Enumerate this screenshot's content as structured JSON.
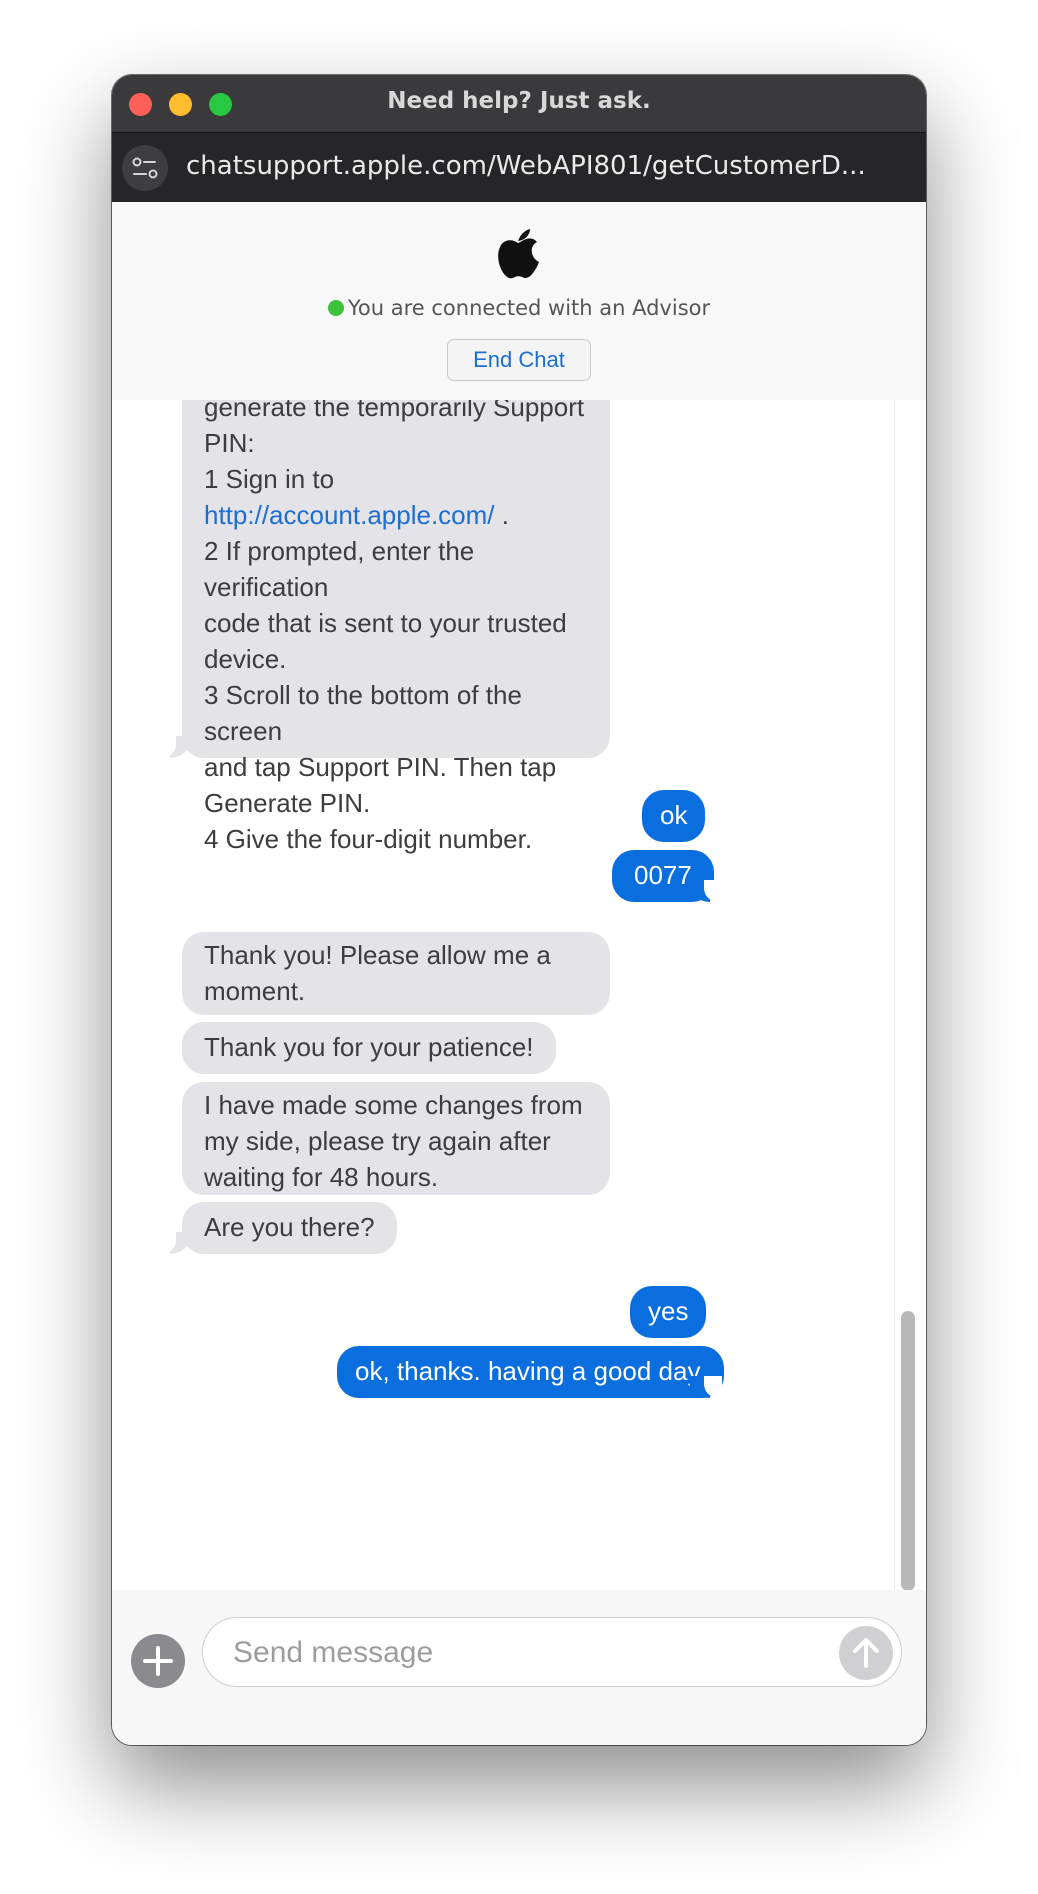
{
  "window": {
    "title": "Need help? Just ask."
  },
  "browser": {
    "url": "chatsupport.apple.com/WebAPI801/getCustomerD..."
  },
  "header": {
    "logo_icon": "apple-logo-icon",
    "status_text": "You are connected with an Advisor",
    "status_color": "#3cc13b",
    "end_chat_label": "End Chat"
  },
  "messages": {
    "m1": {
      "sender": "advisor",
      "lines": [
        "generate the temporarily Support",
        "PIN:",
        "1 Sign in to",
        "http://account.apple.com/",
        " .",
        "2 If prompted, enter the verification",
        "code that is sent to your trusted",
        "device.",
        "3 Scroll to the bottom of the screen",
        "and tap Support PIN. Then tap",
        "Generate PIN.",
        "4 Give the four-digit number."
      ]
    },
    "m2": {
      "sender": "user",
      "text": "ok"
    },
    "m3": {
      "sender": "user",
      "text": "0077"
    },
    "m4": {
      "sender": "advisor",
      "text": "Thank you! Please allow me a moment."
    },
    "m5": {
      "sender": "advisor",
      "text": "Thank you for your patience!"
    },
    "m6": {
      "sender": "advisor",
      "text": "I have made some changes from my side, please try again after waiting for 48 hours."
    },
    "m7": {
      "sender": "advisor",
      "text": "Are you there?"
    },
    "m8": {
      "sender": "user",
      "text": "yes"
    },
    "m9": {
      "sender": "user",
      "text": "ok, thanks. having a good day."
    }
  },
  "composer": {
    "placeholder": "Send message",
    "value": "",
    "add_icon": "plus-icon",
    "send_icon": "arrow-up-icon"
  },
  "colors": {
    "user_bubble": "#0a6edf",
    "advisor_bubble": "#e3e3e8",
    "link": "#1c6ed0"
  }
}
